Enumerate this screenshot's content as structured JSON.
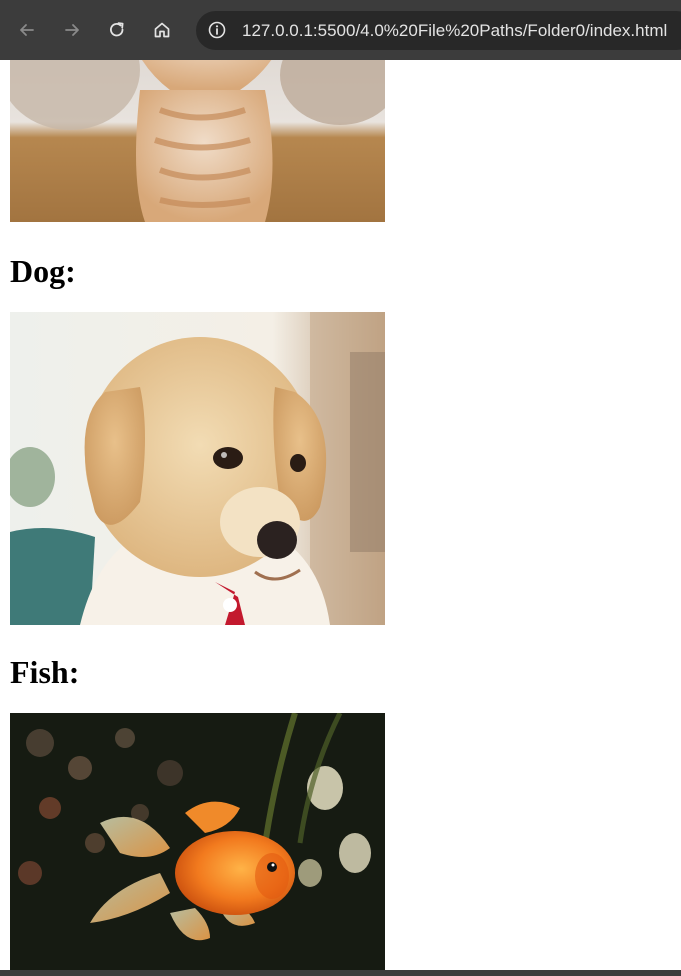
{
  "browser": {
    "url": "127.0.0.1:5500/4.0%20File%20Paths/Folder0/index.html",
    "icons": {
      "back": "arrow-left-icon",
      "forward": "arrow-right-icon",
      "reload": "reload-icon",
      "home": "home-icon",
      "site_info": "info-icon"
    }
  },
  "page": {
    "sections": [
      {
        "heading": ""
      },
      {
        "heading": "Dog:"
      },
      {
        "heading": "Fish:"
      }
    ]
  }
}
